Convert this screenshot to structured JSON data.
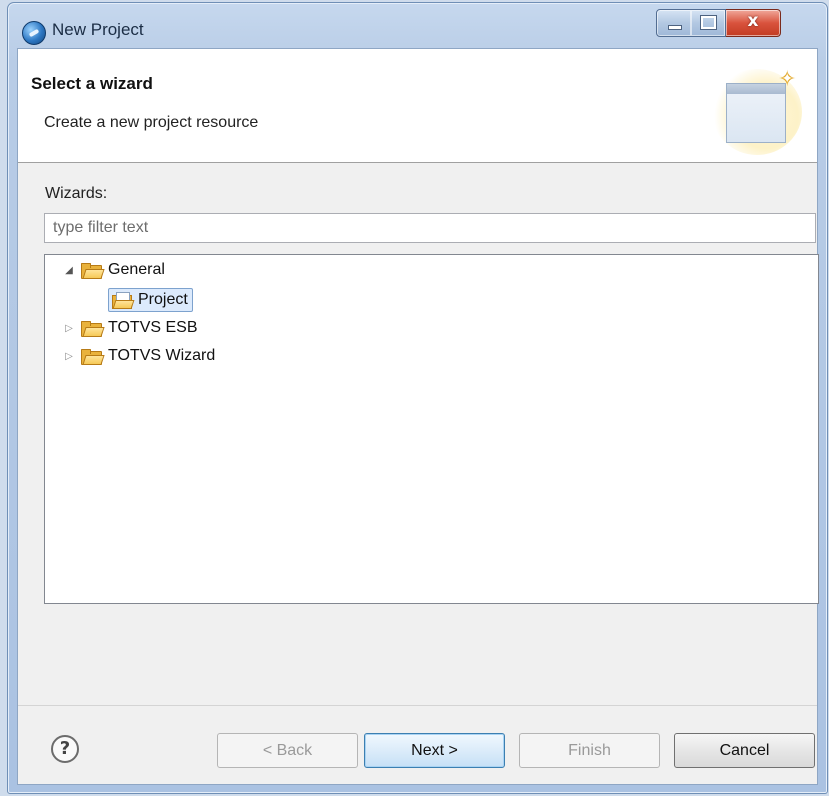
{
  "window": {
    "title": "New Project",
    "close_glyph": "x"
  },
  "header": {
    "title": "Select a wizard",
    "description": "Create a new project resource"
  },
  "wizards": {
    "label": "Wizards:",
    "filter_placeholder": "type filter text",
    "filter_value": "",
    "tree": [
      {
        "label": "General",
        "expanded": true,
        "icon": "folder-icon"
      },
      {
        "label": "Project",
        "selected": true,
        "icon": "project-icon"
      },
      {
        "label": "TOTVS ESB",
        "expanded": false,
        "icon": "folder-icon"
      },
      {
        "label": "TOTVS Wizard",
        "expanded": false,
        "icon": "folder-icon"
      }
    ]
  },
  "footer": {
    "help_glyph": "?",
    "back_label": "< Back",
    "next_label": "Next >",
    "finish_label": "Finish",
    "cancel_label": "Cancel"
  },
  "icons": {
    "expanded_glyph": "◢",
    "collapsed_glyph": "▷",
    "star_glyph": "✧"
  },
  "colors": {
    "selection_bg": "#dceafc",
    "folder": "#e9b23c",
    "close_button": "#d9533d",
    "default_button_border": "#3c7fb1"
  }
}
